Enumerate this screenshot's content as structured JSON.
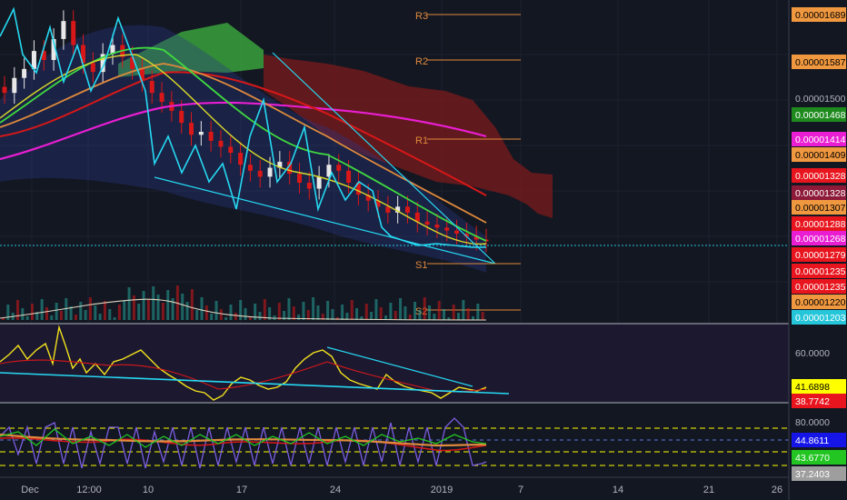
{
  "chart_data": {
    "type": "candlestick-multi-pane",
    "panes": [
      {
        "id": "price",
        "price_tags": [
          {
            "label": "0.00001689",
            "bg": "#f0983f",
            "fg": "#000000"
          },
          {
            "label": "0.00001587",
            "bg": "#f0983f",
            "fg": "#000000"
          },
          {
            "label": "0.00001500",
            "bg": "",
            "fg": "#b2b5be"
          },
          {
            "label": "0.00001468",
            "bg": "#1e8a1e",
            "fg": "#ffffff"
          },
          {
            "label": "0.00001414",
            "bg": "#e91ed2",
            "fg": "#ffffff"
          },
          {
            "label": "0.00001409",
            "bg": "#f0983f",
            "fg": "#000000"
          },
          {
            "label": "0.00001328",
            "bg": "#e8151e",
            "fg": "#ffffff"
          },
          {
            "label": "0.00001328",
            "bg": "#8e1a3a",
            "fg": "#ffffff"
          },
          {
            "label": "0.00001307",
            "bg": "#f0983f",
            "fg": "#000000"
          },
          {
            "label": "0.00001288",
            "bg": "#e8151e",
            "fg": "#ffffff"
          },
          {
            "label": "0.00001268",
            "bg": "#e91ed2",
            "fg": "#ffffff"
          },
          {
            "label": "0.00001279",
            "bg": "#e8151e",
            "fg": "#ffffff"
          },
          {
            "label": "0.00001235",
            "bg": "#e8151e",
            "fg": "#ffffff"
          },
          {
            "label": "0.00001235",
            "bg": "#e8151e",
            "fg": "#ffffff"
          },
          {
            "label": "0.00001220",
            "bg": "#f0983f",
            "fg": "#000000"
          },
          {
            "label": "0.00001203",
            "bg": "#26c6da",
            "fg": "#ffffff"
          }
        ],
        "pivots": [
          "R3",
          "R2",
          "R1",
          "S1",
          "S2"
        ]
      },
      {
        "id": "rsi",
        "labels": [
          {
            "label": "60.0000",
            "bg": "",
            "fg": "#b2b5be"
          },
          {
            "label": "41.6898",
            "bg": "#ffff00",
            "fg": "#000000"
          },
          {
            "label": "38.7742",
            "bg": "#e8151e",
            "fg": "#ffffff"
          }
        ]
      },
      {
        "id": "stoch",
        "labels": [
          {
            "label": "80.0000",
            "bg": "",
            "fg": "#b2b5be"
          },
          {
            "label": "44.8611",
            "bg": "#1515e8",
            "fg": "#ffffff"
          },
          {
            "label": "43.6770",
            "bg": "#22c522",
            "fg": "#ffffff"
          },
          {
            "label": "37.2403",
            "bg": "#9e9e9e",
            "fg": "#ffffff"
          }
        ]
      }
    ],
    "x_labels": [
      "Dec",
      "12:00",
      "10",
      "17",
      "24",
      "2019",
      "7",
      "14",
      "21",
      "26"
    ],
    "series": [
      {
        "values": [
          1520,
          1545,
          1560,
          1590,
          1575,
          1610,
          1640,
          1600,
          1570,
          1555,
          1585,
          1600,
          1580,
          1560,
          1540,
          1520,
          1505,
          1490,
          1470,
          1450,
          1455,
          1440,
          1430,
          1420,
          1400,
          1390,
          1380,
          1395,
          1405,
          1385,
          1370,
          1360,
          1380,
          1400,
          1390,
          1370,
          1350,
          1340,
          1330,
          1320,
          1330,
          1320,
          1305,
          1300,
          1295,
          1290,
          1285,
          1280,
          1275,
          1272
        ]
      }
    ]
  }
}
